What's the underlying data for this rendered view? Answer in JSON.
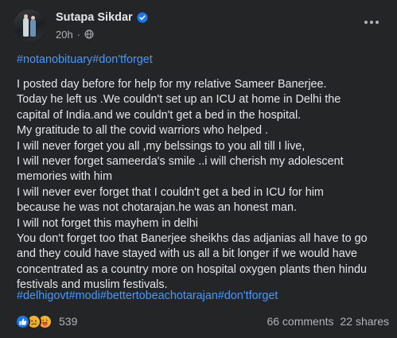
{
  "post": {
    "author": "Sutapa Sikdar",
    "time": "20h",
    "separator": "·",
    "hashtags_top": [
      "#notanobituary",
      "#don'tforget"
    ],
    "lines": [
      "I posted day before for help for my relative Sameer Banerjee.",
      "Today he left us .We couldn't set up an ICU at home in Delhi the",
      "capital of India.and we couldn't get a bed in the hospital.",
      "My gratitude to all the covid warriors who helped .",
      "I will never forget you all ,my belssings to you all till I live,",
      "I will never forget sameerda's smile ..i will cherish my adolescent",
      "memories  with him",
      " I will never ever forget that I couldn't get a bed in ICU for him",
      "because he was not chotarajan.he was an honest man.",
      "I will not forget this mayhem in delhi",
      "You don't forget too that Banerjee sheikhs das adjanias all have to go",
      "and they could have  stayed  with us all  a bit longer if we would  have",
      "concentrated as a country more on hospital oxygen plants then hindu",
      "festivals and muslim festivals."
    ],
    "hashtags_bottom": [
      "#delhigovt",
      "#modi",
      "#bettertobeachotarajan",
      "#don'tforget"
    ]
  },
  "footer": {
    "reaction_count": "539",
    "comments": "66 comments",
    "shares": "22 shares"
  },
  "icons": {
    "verified": "verified-badge-icon",
    "privacy": "globe-icon",
    "more": "more-options-icon",
    "reactions": [
      "like-icon",
      "sad-icon",
      "care-icon"
    ]
  },
  "colors": {
    "background": "#242526",
    "text": "#e4e6eb",
    "secondary_text": "#b0b3b8",
    "hashtag": "#4599ff",
    "like_blue": "#1877f2",
    "emoji_yellow": "#f7b125"
  }
}
